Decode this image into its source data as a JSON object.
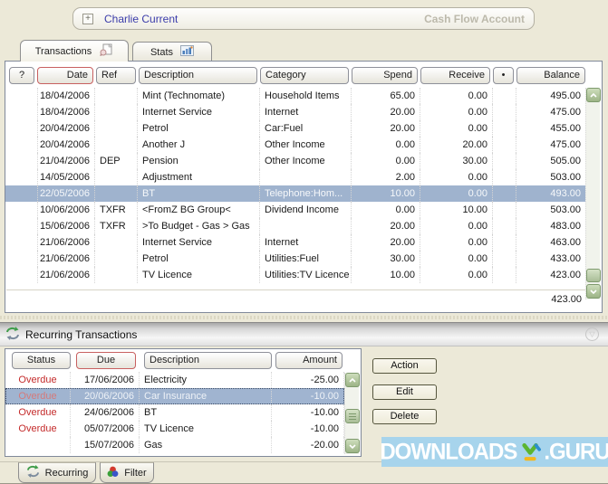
{
  "account_bar": {
    "expand_icon": "+",
    "name": "Charlie Current",
    "type": "Cash Flow Account"
  },
  "tabs": {
    "transactions": "Transactions",
    "stats": "Stats"
  },
  "register": {
    "headers": {
      "help": "?",
      "date": "Date",
      "ref": "Ref",
      "description": "Description",
      "category": "Category",
      "spend": "Spend",
      "receive": "Receive",
      "reconciled": "•",
      "balance": "Balance"
    },
    "rows": [
      {
        "date": "18/04/2006",
        "ref": "",
        "description": "Mint (Technomate)",
        "category": "Household Items",
        "spend": "65.00",
        "receive": "0.00",
        "balance": "495.00"
      },
      {
        "date": "18/04/2006",
        "ref": "",
        "description": "Internet Service",
        "category": "Internet",
        "spend": "20.00",
        "receive": "0.00",
        "balance": "475.00"
      },
      {
        "date": "20/04/2006",
        "ref": "",
        "description": "Petrol",
        "category": "Car:Fuel",
        "spend": "20.00",
        "receive": "0.00",
        "balance": "455.00"
      },
      {
        "date": "20/04/2006",
        "ref": "",
        "description": "Another J",
        "category": "Other Income",
        "spend": "0.00",
        "receive": "20.00",
        "balance": "475.00"
      },
      {
        "date": "21/04/2006",
        "ref": "DEP",
        "description": "Pension",
        "category": "Other Income",
        "spend": "0.00",
        "receive": "30.00",
        "balance": "505.00"
      },
      {
        "date": "14/05/2006",
        "ref": "",
        "description": "Adjustment",
        "category": "",
        "spend": "2.00",
        "receive": "0.00",
        "balance": "503.00"
      },
      {
        "date": "22/05/2006",
        "ref": "",
        "description": "BT",
        "category": "Telephone:Hom...",
        "spend": "10.00",
        "receive": "0.00",
        "balance": "493.00"
      },
      {
        "date": "10/06/2006",
        "ref": "TXFR",
        "description": "<FromZ BG Group<",
        "category": "Dividend Income",
        "spend": "0.00",
        "receive": "10.00",
        "balance": "503.00"
      },
      {
        "date": "15/06/2006",
        "ref": "TXFR",
        "description": ">To Budget - Gas > Gas",
        "category": "",
        "spend": "20.00",
        "receive": "0.00",
        "balance": "483.00"
      },
      {
        "date": "21/06/2006",
        "ref": "",
        "description": "Internet Service",
        "category": "Internet",
        "spend": "20.00",
        "receive": "0.00",
        "balance": "463.00"
      },
      {
        "date": "21/06/2006",
        "ref": "",
        "description": "Petrol",
        "category": "Utilities:Fuel",
        "spend": "30.00",
        "receive": "0.00",
        "balance": "433.00"
      },
      {
        "date": "21/06/2006",
        "ref": "",
        "description": "TV Licence",
        "category": "Utilities:TV Licence",
        "spend": "10.00",
        "receive": "0.00",
        "balance": "423.00"
      }
    ],
    "selected_row_index": 6,
    "total": "423.00"
  },
  "recurring": {
    "title": "Recurring Transactions",
    "headers": {
      "status": "Status",
      "due": "Due",
      "description": "Description",
      "amount": "Amount"
    },
    "rows": [
      {
        "status": "Overdue",
        "due": "17/06/2006",
        "description": "Electricity",
        "amount": "-25.00"
      },
      {
        "status": "Overdue",
        "due": "20/06/2006",
        "description": "Car Insurance",
        "amount": "-10.00"
      },
      {
        "status": "Overdue",
        "due": "24/06/2006",
        "description": "BT",
        "amount": "-10.00"
      },
      {
        "status": "Overdue",
        "due": "05/07/2006",
        "description": "TV Licence",
        "amount": "-10.00"
      },
      {
        "status": "",
        "due": "15/07/2006",
        "description": "Gas",
        "amount": "-20.00"
      }
    ],
    "selected_row_index": 1,
    "buttons": {
      "action": "Action",
      "edit": "Edit",
      "delete": "Delete"
    }
  },
  "bottom_tabs": {
    "recurring": "Recurring",
    "filter": "Filter"
  },
  "watermark": {
    "left": "DOWNLOADS",
    "right": ".GURU"
  },
  "colors": {
    "selection": "#9fb3ce",
    "overdue_red": "#c42b2b",
    "sort_outline": "#c86060",
    "watermark_bg": "#a7d4ec",
    "scrollbar_green": "#a9bd97",
    "account_link_blue": "#3b3caa",
    "background_beige": "#ece9d8"
  }
}
